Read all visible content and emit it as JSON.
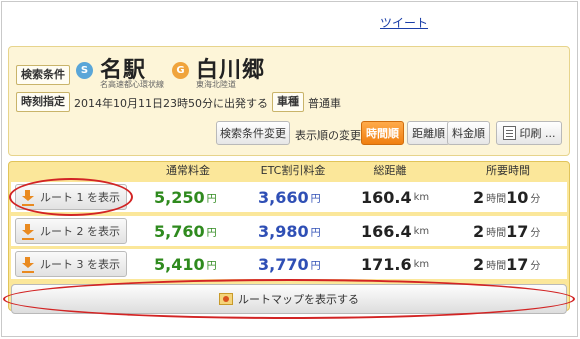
{
  "tweet_link": "ツイート",
  "condition": {
    "label": "検索条件",
    "from": {
      "badge": "S",
      "name": "名駅",
      "sub": "名高速都心環状線"
    },
    "to": {
      "badge": "G",
      "name": "白川郷",
      "sub": "東海北陸道"
    },
    "time_label": "時刻指定",
    "time_value": "2014年10月11日23時50分に出発する",
    "vehicle_label": "車種",
    "vehicle_value": "普通車",
    "change_button": "検索条件変更",
    "order_label": "表示順の変更",
    "sort_time": "時間順",
    "sort_distance": "距離順",
    "sort_fare": "料金順",
    "print_button": "印刷 ..."
  },
  "table": {
    "headers": {
      "normal_fare": "通常料金",
      "etc_fare": "ETC割引料金",
      "distance": "総距離",
      "time": "所要時間"
    },
    "rows": [
      {
        "button": "ルート 1 を表示",
        "normal": "5,250",
        "etc": "3,660",
        "distance": "160.4",
        "hours": "2",
        "minutes": "10"
      },
      {
        "button": "ルート 2 を表示",
        "normal": "5,760",
        "etc": "3,980",
        "distance": "166.4",
        "hours": "2",
        "minutes": "17"
      },
      {
        "button": "ルート 3 を表示",
        "normal": "5,410",
        "etc": "3,770",
        "distance": "171.6",
        "hours": "2",
        "minutes": "17"
      }
    ],
    "units": {
      "yen": "円",
      "km": "km",
      "hour": "時間",
      "minute": "分"
    }
  },
  "map_button": "ルートマップを表示する",
  "colors": {
    "accent_orange": "#f07f10",
    "fare_green": "#2f8a1e",
    "etc_blue": "#2f4fb5",
    "highlight_red": "#d22424"
  }
}
